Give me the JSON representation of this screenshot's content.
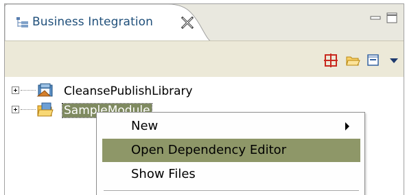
{
  "view": {
    "tab_title": "Business Integration",
    "tab_icon": "tree-view-icon",
    "close_icon": "close-icon",
    "minimize_icon": "minimize-icon",
    "maximize_icon": "maximize-icon"
  },
  "toolbar": {
    "buttons": [
      {
        "name": "new-project-icon"
      },
      {
        "name": "open-folder-icon"
      },
      {
        "name": "collapse-all-icon"
      },
      {
        "name": "view-menu-icon"
      }
    ]
  },
  "tree": {
    "items": [
      {
        "label": "CleansePublishLibrary",
        "icon": "library-icon"
      },
      {
        "label": "SampleModule",
        "icon": "module-icon",
        "selected": true
      }
    ]
  },
  "context_menu": {
    "items": [
      {
        "label": "New",
        "has_submenu": true
      },
      {
        "label": "Open Dependency Editor",
        "highlighted": true
      },
      {
        "label": "Show Files"
      }
    ]
  },
  "colors": {
    "selection": "#7f8a60",
    "menu_highlight": "#8e9768",
    "tab_text": "#1f4f7a",
    "toolbar_bg": "#ece9d8"
  }
}
